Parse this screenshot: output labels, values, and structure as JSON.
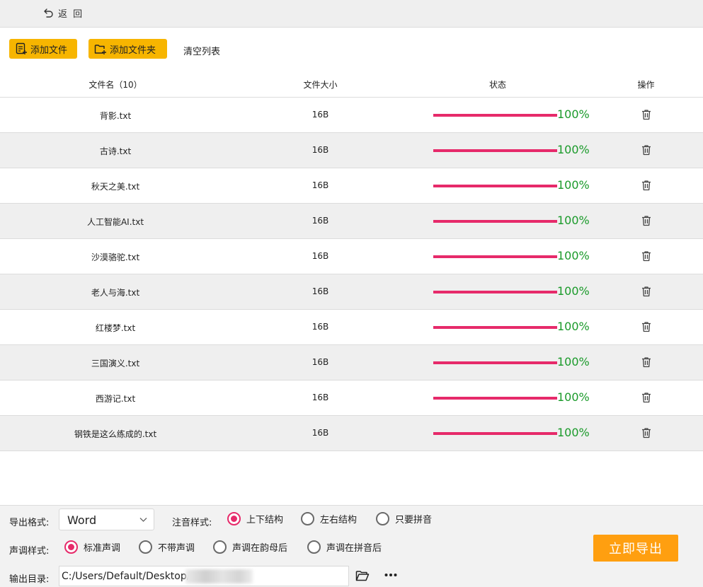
{
  "topbar": {
    "back_label": "返 回"
  },
  "toolbar": {
    "add_file": "添加文件",
    "add_folder": "添加文件夹",
    "clear_list": "清空列表"
  },
  "table": {
    "headers": {
      "name": "文件名（10）",
      "size": "文件大小",
      "status": "状态",
      "op": "操作"
    },
    "rows": [
      {
        "name": "背影.txt",
        "size": "16B",
        "progress": 100,
        "percent": "100%"
      },
      {
        "name": "古诗.txt",
        "size": "16B",
        "progress": 100,
        "percent": "100%"
      },
      {
        "name": "秋天之美.txt",
        "size": "16B",
        "progress": 100,
        "percent": "100%"
      },
      {
        "name": "人工智能AI.txt",
        "size": "16B",
        "progress": 100,
        "percent": "100%"
      },
      {
        "name": "沙漠骆驼.txt",
        "size": "16B",
        "progress": 100,
        "percent": "100%"
      },
      {
        "name": "老人与海.txt",
        "size": "16B",
        "progress": 100,
        "percent": "100%"
      },
      {
        "name": "红楼梦.txt",
        "size": "16B",
        "progress": 100,
        "percent": "100%"
      },
      {
        "name": "三国演义.txt",
        "size": "16B",
        "progress": 100,
        "percent": "100%"
      },
      {
        "name": "西游记.txt",
        "size": "16B",
        "progress": 100,
        "percent": "100%"
      },
      {
        "name": "钢铁是这么练成的.txt",
        "size": "16B",
        "progress": 100,
        "percent": "100%"
      }
    ]
  },
  "bottom": {
    "format_label": "导出格式:",
    "format_value": "Word",
    "annotation_label": "注音样式:",
    "annotation_options": [
      "上下结构",
      "左右结构",
      "只要拼音"
    ],
    "annotation_selected": 0,
    "tone_label": "声调样式:",
    "tone_options": [
      "标准声调",
      "不带声调",
      "声调在韵母后",
      "声调在拼音后"
    ],
    "tone_selected": 0,
    "output_label": "输出目录:",
    "output_path": "C:/Users/Default/Desktop/",
    "export_button": "立即导出"
  },
  "colors": {
    "accent_pink": "#e62a6a",
    "button_yellow": "#f7b500",
    "export_orange": "#ff9f10",
    "percent_green": "#1a9a2a"
  },
  "icons": {
    "back": "back-arrow-icon",
    "add_file": "file-add-icon",
    "add_folder": "folder-add-icon",
    "delete": "trash-icon",
    "browse": "folder-open-icon",
    "more": "more-dots-icon"
  }
}
